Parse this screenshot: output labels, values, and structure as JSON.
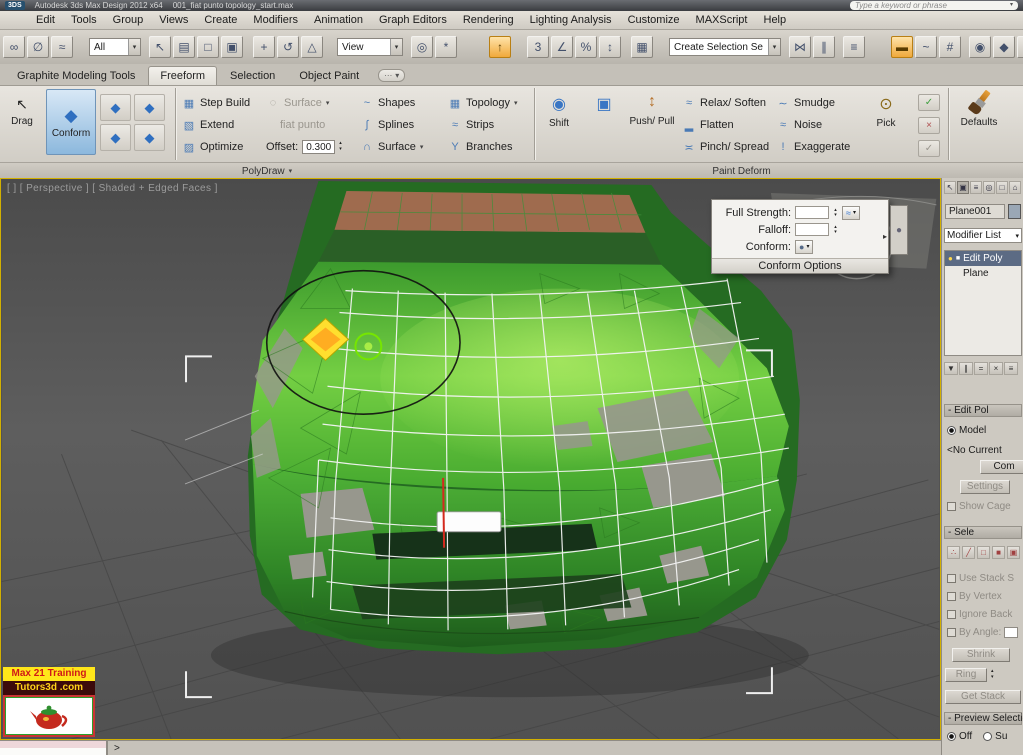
{
  "titlebar": {
    "app_button": "3DS",
    "title": "Autodesk 3ds Max Design 2012 x64",
    "filename": "001_fiat punto topology_start.max",
    "search_placeholder": "Type a keyword or phrase"
  },
  "menubar": {
    "items": [
      "Edit",
      "Tools",
      "Group",
      "Views",
      "Create",
      "Modifiers",
      "Animation",
      "Graph Editors",
      "Rendering",
      "Lighting Analysis",
      "Customize",
      "MAXScript",
      "Help"
    ]
  },
  "toolbar": {
    "selection_filter_value": "All",
    "coord_system_value": "View",
    "named_selection_value": "Create Selection Se"
  },
  "ribbon": {
    "tabs": [
      {
        "label": "Graphite Modeling Tools"
      },
      {
        "label": "Freeform"
      },
      {
        "label": "Selection"
      },
      {
        "label": "Object Paint"
      }
    ],
    "drag_label": "Drag",
    "conform_label": "Conform",
    "polydraw": {
      "caption": "PolyDraw",
      "step_build": "Step Build",
      "extend": "Extend",
      "optimize": "Optimize",
      "surface_btn": "Surface",
      "surface_obj": "fiat punto",
      "offset_label": "Offset:",
      "offset_value": "0.300",
      "shapes": "Shapes",
      "splines": "Splines",
      "surface2": "Surface",
      "topology": "Topology",
      "strips": "Strips",
      "branches": "Branches"
    },
    "paint_deform": {
      "caption": "Paint Deform",
      "shift": "Shift",
      "push_pull": "Push/ Pull",
      "relax": "Relax/ Soften",
      "flatten": "Flatten",
      "pinch": "Pinch/ Spread",
      "smudge": "Smudge",
      "noise": "Noise",
      "exaggerate": "Exaggerate",
      "pick": "Pick",
      "defaults": "Defaults"
    }
  },
  "viewport": {
    "label": "[ ] [ Perspective ] [ Shaded + Edged Faces ]",
    "popup": {
      "full_strength_label": "Full Strength:",
      "falloff_label": "Falloff:",
      "conform_label": "Conform:",
      "caption": "Conform Options"
    }
  },
  "command_panel": {
    "object_name": "Plane001",
    "modifier_list": "Modifier List",
    "stack_item_1": "Edit Poly",
    "stack_item_2": "Plane",
    "edit_poly": {
      "header": "- Edit Pol",
      "model_radio": "Model",
      "current_op": "<No Current",
      "commit": "Com",
      "settings": "Settings",
      "show_cage": "Show Cage"
    },
    "selection": {
      "header": "- Sele",
      "use_stack": "Use Stack S",
      "by_vertex": "By Vertex",
      "ignore_back": "Ignore Back",
      "by_angle": "By Angle:",
      "shrink": "Shrink",
      "ring": "Ring",
      "get_stack": "Get Stack"
    },
    "preview": {
      "header": "- Preview Selectio",
      "off_radio": "Off",
      "sub_radio": "Su"
    }
  },
  "watermark": {
    "line1": "Max 21 Training",
    "line2": "Tutors3d .com"
  },
  "statusbar": {
    "prompt": ">"
  },
  "icons": {
    "dropdown-arrow": "▾",
    "flyout-arrow": "▸",
    "spinner-up": "▴",
    "spinner-down": "▾",
    "overflow-dots": "···",
    "select-link": "∞",
    "unlink": "∅",
    "bind-spacewarp": "≈",
    "select-object": "↖",
    "select-by-name": "▤",
    "region-select": "□",
    "window-crossing": "▣",
    "select-move": "+",
    "select-rotate": "↺",
    "select-scale": "△",
    "pivot-center": "◎",
    "select-manipulate": "*",
    "keyboard-override": "↑",
    "snap-toggle": "3",
    "angle-snap": "∠",
    "percent-snap": "%",
    "spinner-snap": "↕",
    "named-sets": "▦",
    "mirror": "⋈",
    "align": "∥",
    "layers": "≡",
    "ribbon-toggle": "▬",
    "curve-editor": "~",
    "schematic-view": "#",
    "material-editor": "◉",
    "render-setup": "◆",
    "render-frame": "▸",
    "render": "●",
    "drag-cursor": "↖",
    "conform-cube": "◆",
    "step-build": "▦",
    "extend": "▧",
    "optimize": "▨",
    "surface-cyl": "◌",
    "shapes": "~",
    "splines": "∫",
    "surface-arc": "∩",
    "topology": "▦",
    "strips": "≈",
    "branches": "Y",
    "shift-tool": "◉",
    "paint-region": "▣",
    "push-pull": "↕",
    "relax": "≈",
    "flatten": "▂",
    "pinch": "≍",
    "smudge": "∼",
    "noise": "≈",
    "exaggerate": "!",
    "pick-lock": "⊙",
    "commit-check": "✓",
    "cancel-x": "×",
    "revert-check": "✓",
    "popup-flow": "≈",
    "popup-sphere": "●",
    "cp-create": "↖",
    "cp-modify": "▣",
    "cp-hierarchy": "≡",
    "cp-motion": "◎",
    "cp-display": "□",
    "cp-utilities": "⌂",
    "pin": "▼",
    "show-end": "∥",
    "make-unique": "=",
    "remove-mod": "×",
    "config-sets": "≡",
    "bulb": "●",
    "modifier-square": "■",
    "so-vertex": "∴",
    "so-edge": "╱",
    "so-border": "□",
    "so-poly": "■",
    "so-element": "▣"
  }
}
